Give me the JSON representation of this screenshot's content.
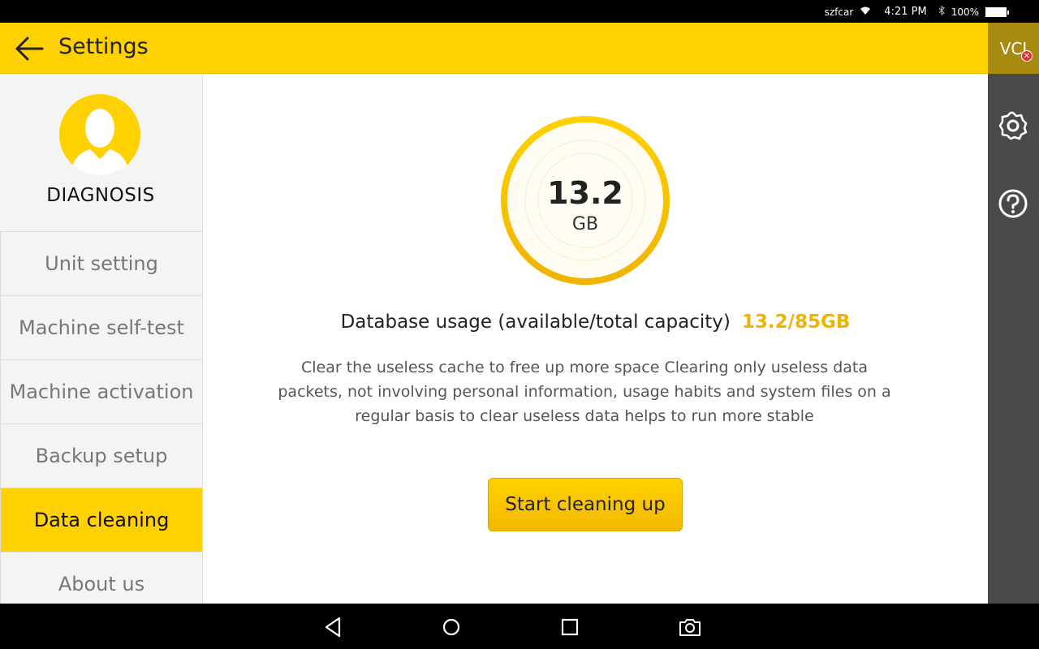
{
  "status_bar": {
    "carrier": "szfcar",
    "time": "4:21 PM",
    "battery": "100%"
  },
  "header": {
    "title": "Settings",
    "vci_label": "VCI"
  },
  "sidebar": {
    "profile_name": "DIAGNOSIS",
    "items": [
      {
        "label": "Unit setting"
      },
      {
        "label": "Machine self-test"
      },
      {
        "label": "Machine activation"
      },
      {
        "label": "Backup setup"
      },
      {
        "label": "Data cleaning"
      },
      {
        "label": "About us"
      }
    ],
    "active_index": 4
  },
  "main": {
    "gauge_value": "13.2",
    "gauge_unit": "GB",
    "usage_label": "Database usage (available/total capacity)",
    "usage_value": "13.2/85GB",
    "description": "Clear the useless cache to free up more space Clearing only useless data packets, not involving personal information, usage habits and system files on a regular basis to clear useless data helps to run more stable",
    "button_label": "Start cleaning up"
  },
  "colors": {
    "accent": "#FFD100",
    "value_highlight": "#f0b400",
    "right_bar": "#4a4a4a"
  },
  "icons": [
    "wifi-icon",
    "bluetooth-icon",
    "battery-icon",
    "back-arrow-icon",
    "gear-icon",
    "help-icon",
    "avatar-icon",
    "nav-back-icon",
    "nav-home-icon",
    "nav-recents-icon",
    "camera-icon"
  ]
}
